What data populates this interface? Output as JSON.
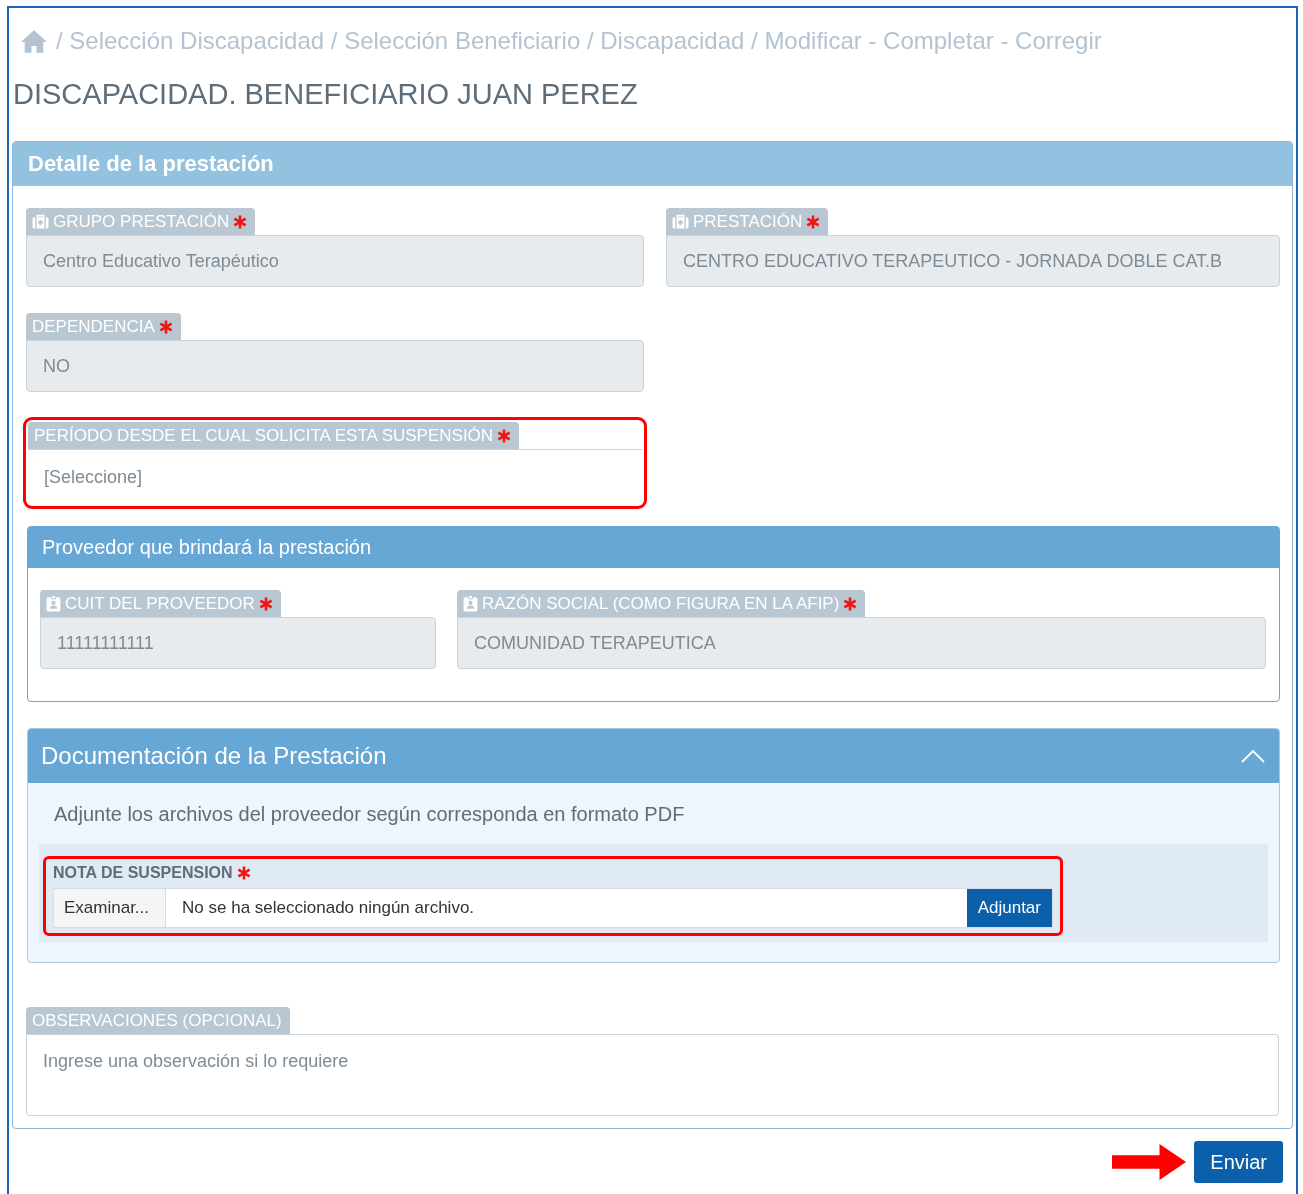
{
  "breadcrumb": {
    "text": "/ Selección Discapacidad / Selección Beneficiario / Discapacidad / Modificar - Completar - Corregir"
  },
  "title": "DISCAPACIDAD. BENEFICIARIO JUAN PEREZ",
  "detail": {
    "title": "Detalle de la prestación",
    "rows": [
      [
        {
          "label": "GRUPO PRESTACIÓN",
          "value": "Centro Educativo Terapéutico",
          "kind": "readonly",
          "required": true,
          "highlighted": false
        },
        {
          "label": "PRESTACIÓN",
          "value": "CENTRO EDUCATIVO TERAPEUTICO - JORNADA DOBLE CAT.B",
          "kind": "readonly",
          "required": true,
          "highlighted": false
        }
      ],
      [
        {
          "label": "DEPENDENCIA",
          "value": "NO",
          "kind": "readonly",
          "required": true,
          "highlighted": false
        }
      ],
      [
        {
          "label": "PERÍODO DESDE EL CUAL SOLICITA ESTA SUSPENSIÓN",
          "value": "[Seleccione]",
          "kind": "select",
          "required": true,
          "highlighted": true
        }
      ]
    ]
  },
  "provider": {
    "title": "Proveedor que brindará la prestación",
    "fields": [
      {
        "label": "CUIT DEL PROVEEDOR",
        "value": "11111111111",
        "kind": "readonly",
        "required": true,
        "highlighted": false
      },
      {
        "label": "RAZÓN SOCIAL (COMO FIGURA EN LA AFIP)",
        "value": "COMUNIDAD TERAPEUTICA",
        "kind": "readonly",
        "required": true,
        "highlighted": false
      }
    ]
  },
  "documents": {
    "title": "Documentación de la Prestación",
    "expanded": true,
    "hint": "Adjunte los archivos del proveedor según corresponda en formato PDF",
    "uploads": [
      {
        "label": "NOTA DE SUSPENSION",
        "required": true,
        "highlighted": true,
        "browse": "Examinar...",
        "status": "No se ha seleccionado ningún archivo.",
        "attach": "Adjuntar"
      }
    ]
  },
  "notes": {
    "label": "OBSERVACIONES (OPCIONAL)",
    "placeholder": "Ingrese una observación si lo requiere",
    "required": false
  },
  "submit": {
    "label": "Enviar",
    "pointer_arrow": true
  }
}
